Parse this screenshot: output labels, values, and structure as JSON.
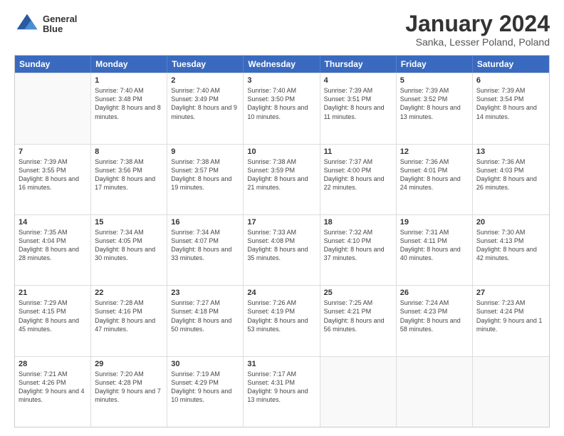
{
  "header": {
    "logo_line1": "General",
    "logo_line2": "Blue",
    "title": "January 2024",
    "subtitle": "Sanka, Lesser Poland, Poland"
  },
  "weekdays": [
    "Sunday",
    "Monday",
    "Tuesday",
    "Wednesday",
    "Thursday",
    "Friday",
    "Saturday"
  ],
  "weeks": [
    [
      {
        "day": "",
        "sunrise": "",
        "sunset": "",
        "daylight": ""
      },
      {
        "day": "1",
        "sunrise": "Sunrise: 7:40 AM",
        "sunset": "Sunset: 3:48 PM",
        "daylight": "Daylight: 8 hours and 8 minutes."
      },
      {
        "day": "2",
        "sunrise": "Sunrise: 7:40 AM",
        "sunset": "Sunset: 3:49 PM",
        "daylight": "Daylight: 8 hours and 9 minutes."
      },
      {
        "day": "3",
        "sunrise": "Sunrise: 7:40 AM",
        "sunset": "Sunset: 3:50 PM",
        "daylight": "Daylight: 8 hours and 10 minutes."
      },
      {
        "day": "4",
        "sunrise": "Sunrise: 7:39 AM",
        "sunset": "Sunset: 3:51 PM",
        "daylight": "Daylight: 8 hours and 11 minutes."
      },
      {
        "day": "5",
        "sunrise": "Sunrise: 7:39 AM",
        "sunset": "Sunset: 3:52 PM",
        "daylight": "Daylight: 8 hours and 13 minutes."
      },
      {
        "day": "6",
        "sunrise": "Sunrise: 7:39 AM",
        "sunset": "Sunset: 3:54 PM",
        "daylight": "Daylight: 8 hours and 14 minutes."
      }
    ],
    [
      {
        "day": "7",
        "sunrise": "Sunrise: 7:39 AM",
        "sunset": "Sunset: 3:55 PM",
        "daylight": "Daylight: 8 hours and 16 minutes."
      },
      {
        "day": "8",
        "sunrise": "Sunrise: 7:38 AM",
        "sunset": "Sunset: 3:56 PM",
        "daylight": "Daylight: 8 hours and 17 minutes."
      },
      {
        "day": "9",
        "sunrise": "Sunrise: 7:38 AM",
        "sunset": "Sunset: 3:57 PM",
        "daylight": "Daylight: 8 hours and 19 minutes."
      },
      {
        "day": "10",
        "sunrise": "Sunrise: 7:38 AM",
        "sunset": "Sunset: 3:59 PM",
        "daylight": "Daylight: 8 hours and 21 minutes."
      },
      {
        "day": "11",
        "sunrise": "Sunrise: 7:37 AM",
        "sunset": "Sunset: 4:00 PM",
        "daylight": "Daylight: 8 hours and 22 minutes."
      },
      {
        "day": "12",
        "sunrise": "Sunrise: 7:36 AM",
        "sunset": "Sunset: 4:01 PM",
        "daylight": "Daylight: 8 hours and 24 minutes."
      },
      {
        "day": "13",
        "sunrise": "Sunrise: 7:36 AM",
        "sunset": "Sunset: 4:03 PM",
        "daylight": "Daylight: 8 hours and 26 minutes."
      }
    ],
    [
      {
        "day": "14",
        "sunrise": "Sunrise: 7:35 AM",
        "sunset": "Sunset: 4:04 PM",
        "daylight": "Daylight: 8 hours and 28 minutes."
      },
      {
        "day": "15",
        "sunrise": "Sunrise: 7:34 AM",
        "sunset": "Sunset: 4:05 PM",
        "daylight": "Daylight: 8 hours and 30 minutes."
      },
      {
        "day": "16",
        "sunrise": "Sunrise: 7:34 AM",
        "sunset": "Sunset: 4:07 PM",
        "daylight": "Daylight: 8 hours and 33 minutes."
      },
      {
        "day": "17",
        "sunrise": "Sunrise: 7:33 AM",
        "sunset": "Sunset: 4:08 PM",
        "daylight": "Daylight: 8 hours and 35 minutes."
      },
      {
        "day": "18",
        "sunrise": "Sunrise: 7:32 AM",
        "sunset": "Sunset: 4:10 PM",
        "daylight": "Daylight: 8 hours and 37 minutes."
      },
      {
        "day": "19",
        "sunrise": "Sunrise: 7:31 AM",
        "sunset": "Sunset: 4:11 PM",
        "daylight": "Daylight: 8 hours and 40 minutes."
      },
      {
        "day": "20",
        "sunrise": "Sunrise: 7:30 AM",
        "sunset": "Sunset: 4:13 PM",
        "daylight": "Daylight: 8 hours and 42 minutes."
      }
    ],
    [
      {
        "day": "21",
        "sunrise": "Sunrise: 7:29 AM",
        "sunset": "Sunset: 4:15 PM",
        "daylight": "Daylight: 8 hours and 45 minutes."
      },
      {
        "day": "22",
        "sunrise": "Sunrise: 7:28 AM",
        "sunset": "Sunset: 4:16 PM",
        "daylight": "Daylight: 8 hours and 47 minutes."
      },
      {
        "day": "23",
        "sunrise": "Sunrise: 7:27 AM",
        "sunset": "Sunset: 4:18 PM",
        "daylight": "Daylight: 8 hours and 50 minutes."
      },
      {
        "day": "24",
        "sunrise": "Sunrise: 7:26 AM",
        "sunset": "Sunset: 4:19 PM",
        "daylight": "Daylight: 8 hours and 53 minutes."
      },
      {
        "day": "25",
        "sunrise": "Sunrise: 7:25 AM",
        "sunset": "Sunset: 4:21 PM",
        "daylight": "Daylight: 8 hours and 56 minutes."
      },
      {
        "day": "26",
        "sunrise": "Sunrise: 7:24 AM",
        "sunset": "Sunset: 4:23 PM",
        "daylight": "Daylight: 8 hours and 58 minutes."
      },
      {
        "day": "27",
        "sunrise": "Sunrise: 7:23 AM",
        "sunset": "Sunset: 4:24 PM",
        "daylight": "Daylight: 9 hours and 1 minute."
      }
    ],
    [
      {
        "day": "28",
        "sunrise": "Sunrise: 7:21 AM",
        "sunset": "Sunset: 4:26 PM",
        "daylight": "Daylight: 9 hours and 4 minutes."
      },
      {
        "day": "29",
        "sunrise": "Sunrise: 7:20 AM",
        "sunset": "Sunset: 4:28 PM",
        "daylight": "Daylight: 9 hours and 7 minutes."
      },
      {
        "day": "30",
        "sunrise": "Sunrise: 7:19 AM",
        "sunset": "Sunset: 4:29 PM",
        "daylight": "Daylight: 9 hours and 10 minutes."
      },
      {
        "day": "31",
        "sunrise": "Sunrise: 7:17 AM",
        "sunset": "Sunset: 4:31 PM",
        "daylight": "Daylight: 9 hours and 13 minutes."
      },
      {
        "day": "",
        "sunrise": "",
        "sunset": "",
        "daylight": ""
      },
      {
        "day": "",
        "sunrise": "",
        "sunset": "",
        "daylight": ""
      },
      {
        "day": "",
        "sunrise": "",
        "sunset": "",
        "daylight": ""
      }
    ]
  ]
}
